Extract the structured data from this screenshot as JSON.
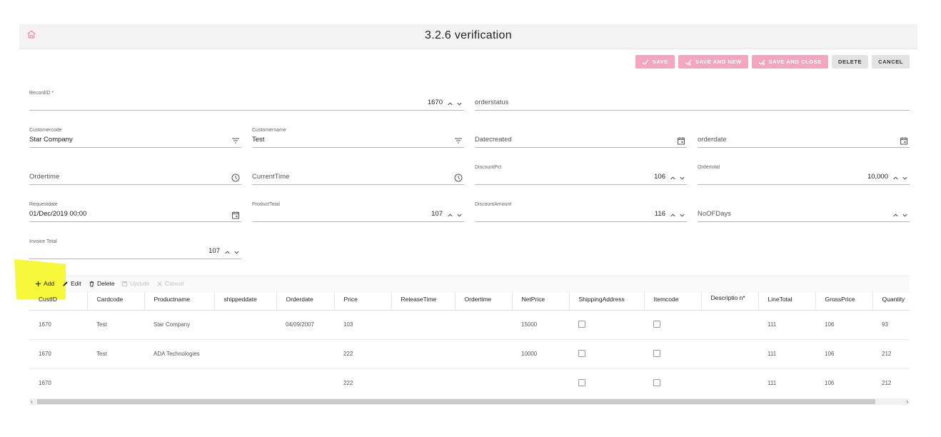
{
  "header": {
    "title": "3.2.6 verification",
    "home_icon": "home-icon"
  },
  "toolbar": {
    "save": "SAVE",
    "save_new": "SAVE AND NEW",
    "save_close": "SAVE AND CLOSE",
    "delete": "DELETE",
    "cancel": "CANCEL"
  },
  "form": {
    "recordid": {
      "label": "RecordID *",
      "value": "1670"
    },
    "orderstatus": {
      "placeholder": "orderstatus"
    },
    "customercode": {
      "label": "Customercode",
      "value": "Star Company"
    },
    "customername": {
      "label": "Customername",
      "value": "Test"
    },
    "datecreated": {
      "placeholder": "Datecreated"
    },
    "orderdate": {
      "placeholder": "orderdate"
    },
    "ordertime": {
      "placeholder": "Ordertime"
    },
    "currenttime": {
      "placeholder": "CurrentTime"
    },
    "discountpct": {
      "label": "DiscountPct",
      "value": "106"
    },
    "ordertotal": {
      "label": "Ordertotal",
      "value": "10,000"
    },
    "requestdate": {
      "label": "Requestdate",
      "value": "01/Dec/2019 00:00"
    },
    "producttotal": {
      "label": "ProductTotal",
      "value": "107"
    },
    "discountamount": {
      "label": "DiscountAmount",
      "value": "116"
    },
    "noofdays": {
      "placeholder": "NoOFDays"
    },
    "invoicetotal": {
      "label": "Invoice Total",
      "value": "107"
    }
  },
  "grid_toolbar": {
    "add": "Add",
    "edit": "Edit",
    "delete": "Delete",
    "update": "Update",
    "cancel": "Cancel"
  },
  "grid": {
    "columns": [
      "CustID",
      "Cardcode",
      "Productname",
      "shippeddate",
      "Orderdate",
      "Price",
      "ReleaseTime",
      "Ordertime",
      "NetPrice",
      "ShippingAddress",
      "Itemcode",
      "Descriptio n*",
      "LineTotal",
      "GrossPrice",
      "Quantity"
    ],
    "rows": [
      {
        "custid": "1670",
        "cardcode": "Test",
        "productname": "Star Company",
        "shippeddate": "",
        "orderdate": "04/09/2007",
        "price": "103",
        "releasetime": "",
        "ordertime": "",
        "netprice": "15000",
        "description": "",
        "linetotal": "111",
        "grossprice": "106",
        "quantity": "93"
      },
      {
        "custid": "1670",
        "cardcode": "Test",
        "productname": "ADA Technologies",
        "shippeddate": "",
        "orderdate": "",
        "price": "222",
        "releasetime": "",
        "ordertime": "",
        "netprice": "10000",
        "description": "",
        "linetotal": "111",
        "grossprice": "106",
        "quantity": "212"
      },
      {
        "custid": "1670",
        "cardcode": "",
        "productname": "",
        "shippeddate": "",
        "orderdate": "",
        "price": "222",
        "releasetime": "",
        "ordertime": "",
        "netprice": "",
        "description": "",
        "linetotal": "111",
        "grossprice": "106",
        "quantity": "212"
      }
    ]
  },
  "colors": {
    "accent": "#f4a6c0",
    "highlight": "#f7f83a",
    "home": "#ef8fb0"
  }
}
